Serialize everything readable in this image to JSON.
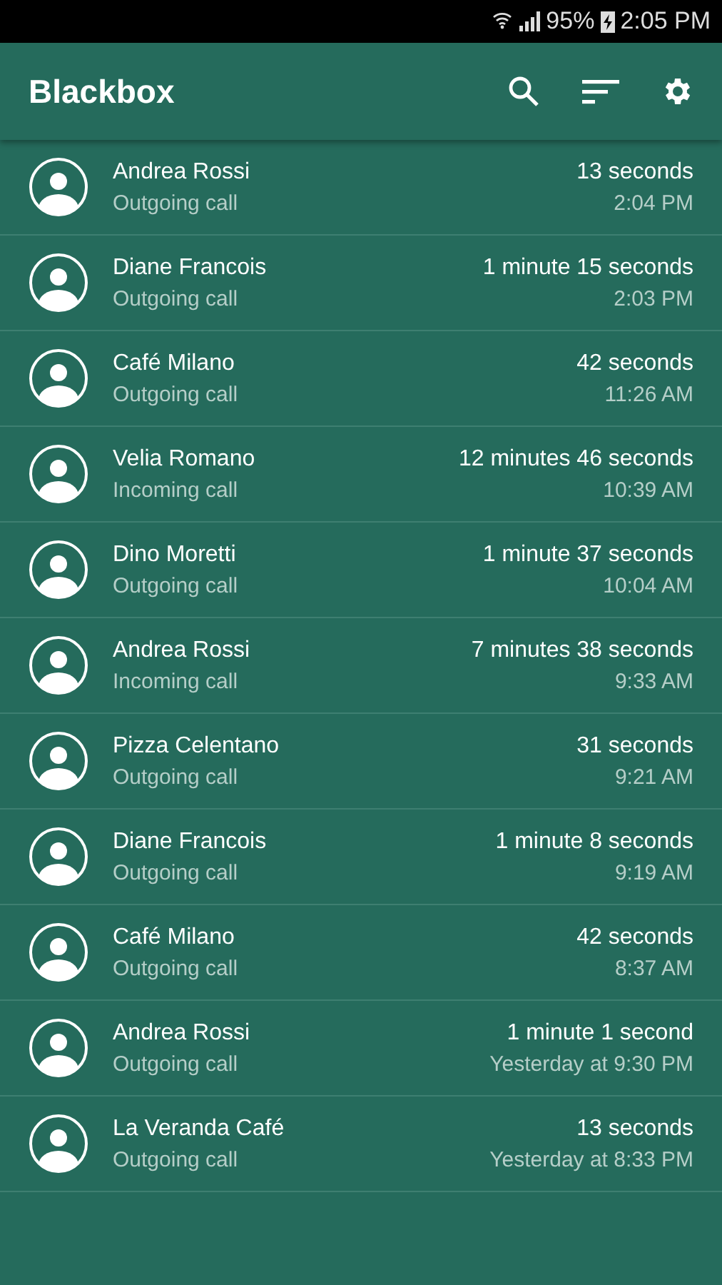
{
  "status_bar": {
    "battery": "95%",
    "time": "2:05 PM"
  },
  "app_bar": {
    "title": "Blackbox"
  },
  "calls": [
    {
      "name": "Andrea Rossi",
      "type": "Outgoing call",
      "duration": "13 seconds",
      "time": "2:04 PM"
    },
    {
      "name": "Diane Francois",
      "type": "Outgoing call",
      "duration": "1 minute 15 seconds",
      "time": "2:03 PM"
    },
    {
      "name": "Café Milano",
      "type": "Outgoing call",
      "duration": "42 seconds",
      "time": "11:26 AM"
    },
    {
      "name": "Velia Romano",
      "type": "Incoming call",
      "duration": "12 minutes 46 seconds",
      "time": "10:39 AM"
    },
    {
      "name": "Dino Moretti",
      "type": "Outgoing call",
      "duration": "1 minute 37 seconds",
      "time": "10:04 AM"
    },
    {
      "name": "Andrea Rossi",
      "type": "Incoming call",
      "duration": "7 minutes 38 seconds",
      "time": "9:33 AM"
    },
    {
      "name": "Pizza Celentano",
      "type": "Outgoing call",
      "duration": "31 seconds",
      "time": "9:21 AM"
    },
    {
      "name": "Diane Francois",
      "type": "Outgoing call",
      "duration": "1 minute 8 seconds",
      "time": "9:19 AM"
    },
    {
      "name": "Café Milano",
      "type": "Outgoing call",
      "duration": "42 seconds",
      "time": "8:37 AM"
    },
    {
      "name": "Andrea Rossi",
      "type": "Outgoing call",
      "duration": "1 minute 1 second",
      "time": "Yesterday at 9:30 PM"
    },
    {
      "name": "La Veranda Café",
      "type": "Outgoing call",
      "duration": "13 seconds",
      "time": "Yesterday at 8:33 PM"
    }
  ]
}
